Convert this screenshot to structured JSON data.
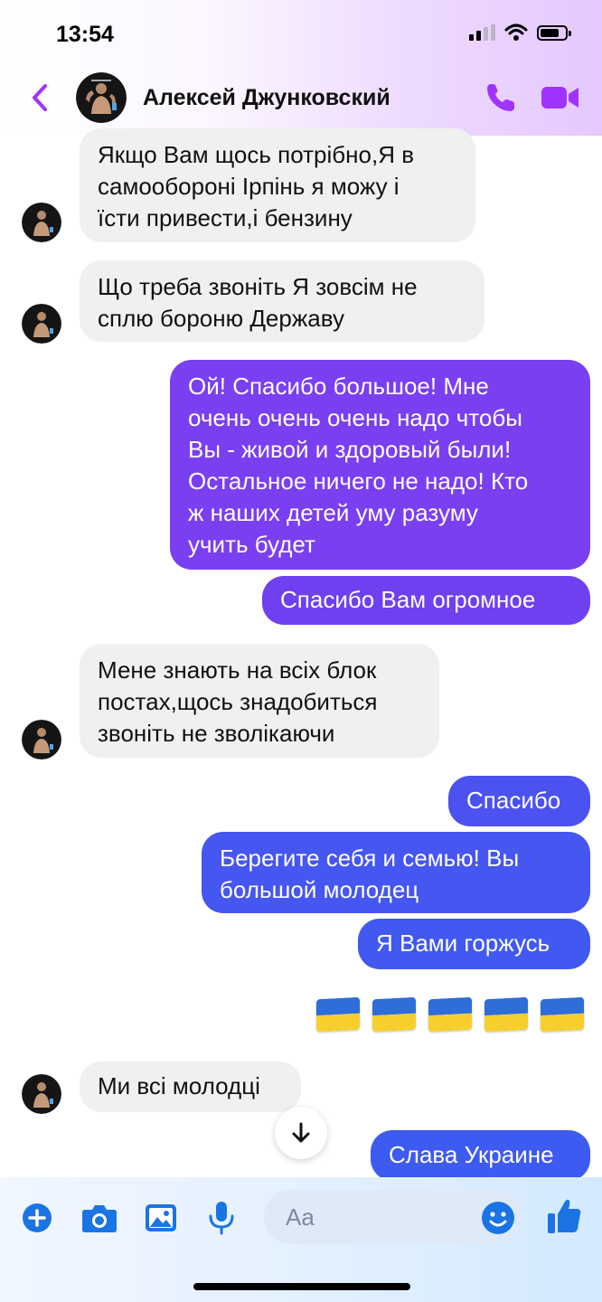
{
  "status_bar": {
    "time": "13:54"
  },
  "header": {
    "contact_name": "Алексей Джунковский"
  },
  "messages": [
    {
      "text": "Якщо Вам щось потрібно,Я в\nсамообороні Ірпінь я можу і\nїсти привести,і бензину"
    },
    {
      "text": "Що треба звоніть Я зовсім не\nсплю бороню Державу"
    },
    {
      "text": "Ой! Спасибо большое! Мне\nочень очень очень надо чтобы\nВы - живой и здоровый были!\nОстальное ничего не надо! Кто\nж наших детей уму разуму\nучить будет"
    },
    {
      "text": "Спасибо Вам огромное"
    },
    {
      "text": "Мене знають на всіх блок\nпостах,щось знадобиться\nзвоніть не зволікаючи"
    },
    {
      "text": "Спасибо"
    },
    {
      "text": "Берегите себя и семью!  Вы\nбольшой молодец"
    },
    {
      "text": "Я Вами горжусь"
    },
    {
      "text": "🇺🇦🇺🇦🇺🇦🇺🇦🇺🇦"
    },
    {
      "text": "Ми всі молодці"
    },
    {
      "text": "Слава Украине"
    }
  ],
  "composer": {
    "placeholder": "Aa"
  },
  "colors": {
    "accent_purple": "#a033ff",
    "outgoing_top": "#7a3ff0",
    "outgoing_bottom": "#3d5af1",
    "incoming_bubble": "#f0f0f0",
    "composer_icon": "#1b74e4"
  },
  "icons": [
    "chevron-left-icon",
    "phone-icon",
    "video-camera-icon",
    "arrow-down-icon",
    "plus-circle-icon",
    "camera-icon",
    "image-icon",
    "microphone-icon",
    "smiley-icon",
    "thumbs-up-icon"
  ]
}
